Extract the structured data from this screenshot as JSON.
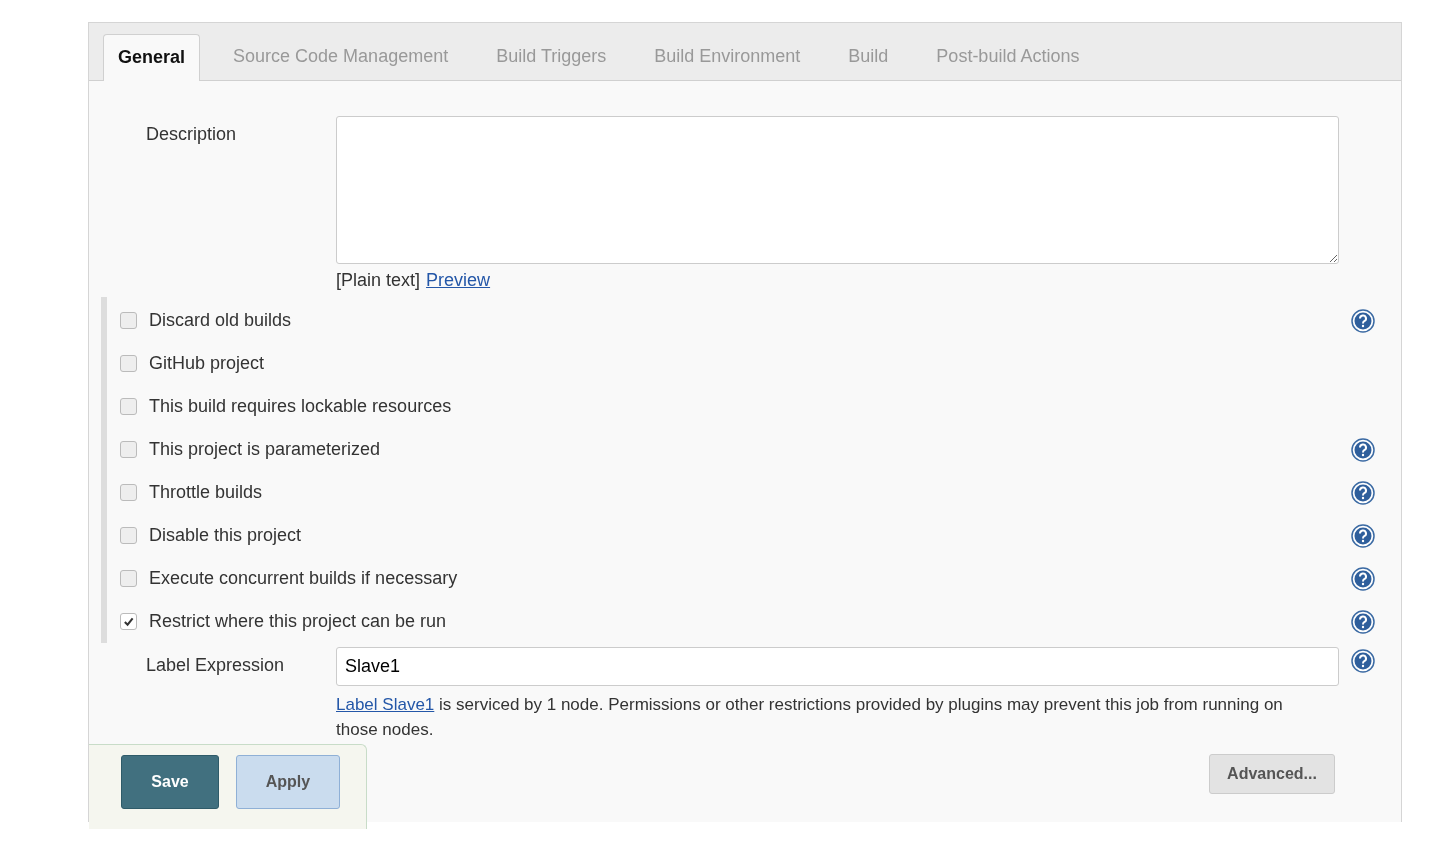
{
  "tabs": [
    {
      "label": "General",
      "selected": true
    },
    {
      "label": "Source Code Management",
      "selected": false
    },
    {
      "label": "Build Triggers",
      "selected": false
    },
    {
      "label": "Build Environment",
      "selected": false
    },
    {
      "label": "Build",
      "selected": false
    },
    {
      "label": "Post-build Actions",
      "selected": false
    }
  ],
  "description": {
    "label": "Description",
    "format": "[Plain text]",
    "preview_link": "Preview"
  },
  "options": [
    {
      "label": "Discard old builds",
      "checked": false,
      "help": true
    },
    {
      "label": "GitHub project",
      "checked": false,
      "help": false
    },
    {
      "label": "This build requires lockable resources",
      "checked": false,
      "help": false
    },
    {
      "label": "This project is parameterized",
      "checked": false,
      "help": true
    },
    {
      "label": "Throttle builds",
      "checked": false,
      "help": true
    },
    {
      "label": "Disable this project",
      "checked": false,
      "help": true
    },
    {
      "label": "Execute concurrent builds if necessary",
      "checked": false,
      "help": true
    },
    {
      "label": "Restrict where this project can be run",
      "checked": true,
      "help": true
    }
  ],
  "label_expression": {
    "label": "Label Expression",
    "value": "Slave1",
    "help": true,
    "link": "Label Slave1",
    "message": "is serviced by 1 node. Permissions or other restrictions provided by plugins may prevent this job from running on those nodes."
  },
  "buttons": {
    "save": "Save",
    "apply": "Apply",
    "advanced": "Advanced..."
  }
}
